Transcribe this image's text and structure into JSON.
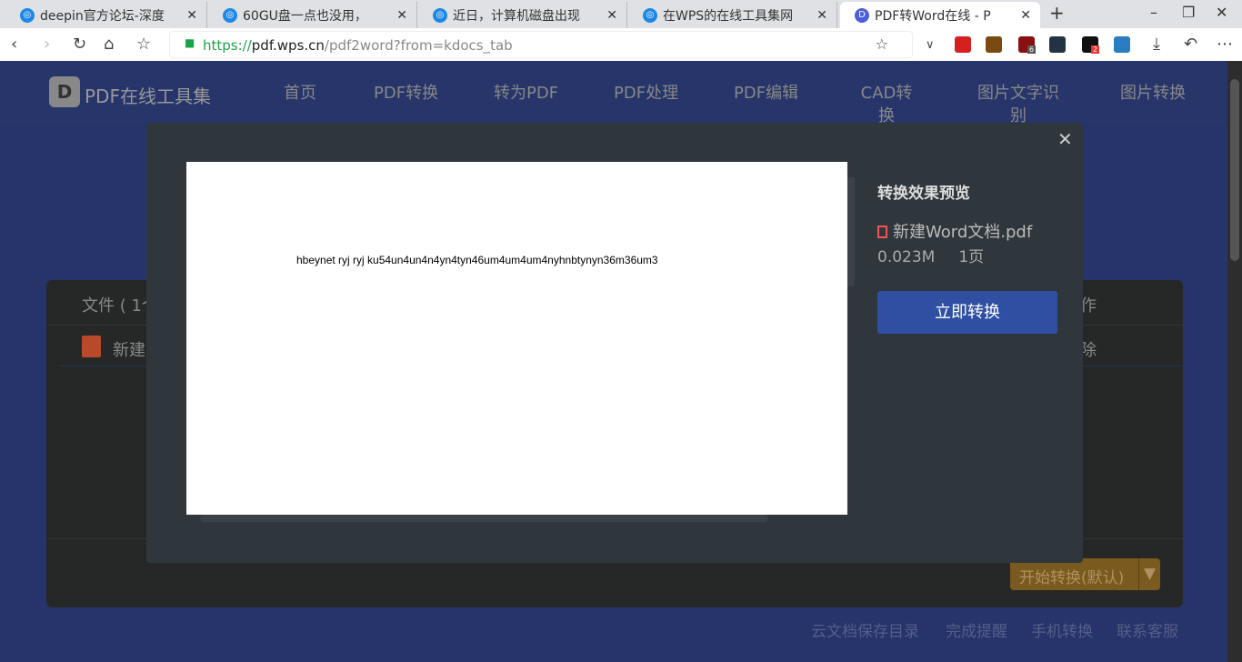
{
  "browser": {
    "tabs": [
      {
        "title": "deepin官方论坛-深度"
      },
      {
        "title": "60GU盘一点也没用，"
      },
      {
        "title": "近日，计算机磁盘出现"
      },
      {
        "title": "在WPS的在线工具集网"
      },
      {
        "title": "PDF转Word在线 - P"
      }
    ],
    "new_tab": "+",
    "url_scheme": "https://",
    "url_host": "pdf.wps.cn",
    "url_path": "/pdf2word?from=kdocs_tab",
    "ext_badges": [
      "6",
      "2"
    ]
  },
  "site": {
    "logo_letter": "D",
    "logo_text": "PDF在线工具集",
    "menu": [
      "首页",
      "PDF转换",
      "转为PDF",
      "PDF处理",
      "PDF编辑",
      "CAD转换",
      "图片文字识别",
      "图片转换"
    ]
  },
  "panel": {
    "files_header": "文件 ( 1个",
    "actions_header": "作",
    "file_name": "新建",
    "delete": "除",
    "start_button": "开始转换(默认)",
    "start_dropdown": "▼"
  },
  "footer": {
    "links": [
      "云文档保存目录",
      "完成提醒",
      "手机转换",
      "联系客服"
    ]
  },
  "modal": {
    "close": "✕",
    "preview_text": "hbeynet  ryj ryj  ku54un4un4n4yn4tyn46um4um4um4nyhnbtynyn36m36um3",
    "title": "转换效果预览",
    "file_name": "新建Word文档.pdf",
    "file_size": "0.023M",
    "pages": "1页",
    "convert_button": "立即转换"
  }
}
